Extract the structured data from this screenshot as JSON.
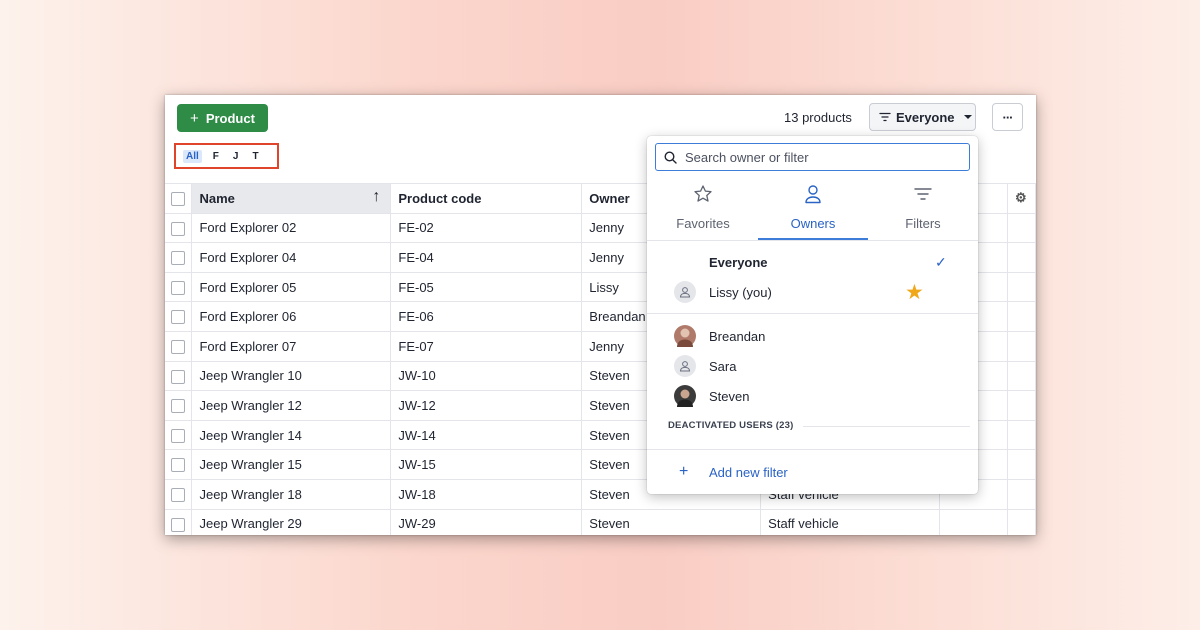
{
  "toolbar": {
    "add_label": "Product",
    "add_icon": "plus-icon",
    "alpha_filters": [
      "All",
      "F",
      "J",
      "T"
    ],
    "active_alpha": "All",
    "count": "13 products",
    "owner_filter_label": "Everyone",
    "more_label": "···"
  },
  "table": {
    "columns": [
      "Name",
      "Product code",
      "Owner",
      "",
      "",
      ""
    ],
    "sorted_column": "Name",
    "rows": [
      [
        "Ford Explorer 02",
        "FE-02",
        "Jenny",
        ""
      ],
      [
        "Ford Explorer 04",
        "FE-04",
        "Jenny",
        ""
      ],
      [
        "Ford Explorer 05",
        "FE-05",
        "Lissy",
        ""
      ],
      [
        "Ford Explorer 06",
        "FE-06",
        "Breandan",
        ""
      ],
      [
        "Ford Explorer 07",
        "FE-07",
        "Jenny",
        ""
      ],
      [
        "Jeep Wrangler 10",
        "JW-10",
        "Steven",
        ""
      ],
      [
        "Jeep Wrangler 12",
        "JW-12",
        "Steven",
        ""
      ],
      [
        "Jeep Wrangler 14",
        "JW-14",
        "Steven",
        ""
      ],
      [
        "Jeep Wrangler 15",
        "JW-15",
        "Steven",
        ""
      ],
      [
        "Jeep Wrangler 18",
        "JW-18",
        "Steven",
        "Staff vehicle"
      ],
      [
        "Jeep Wrangler 29",
        "JW-29",
        "Steven",
        "Staff vehicle"
      ]
    ]
  },
  "popup": {
    "search_placeholder": "Search owner or filter",
    "tabs": [
      {
        "label": "Favorites",
        "icon": "star-outline-icon"
      },
      {
        "label": "Owners",
        "icon": "person-icon"
      },
      {
        "label": "Filters",
        "icon": "filter-lines-icon"
      }
    ],
    "active_tab": "Owners",
    "everyone_label": "Everyone",
    "you_label": "Lissy (you)",
    "owners": [
      "Breandan",
      "Sara",
      "Steven"
    ],
    "deactivated_label": "DEACTIVATED USERS (23)",
    "add_filter_label": "Add new filter"
  },
  "colors": {
    "accent_green": "#2e8c47",
    "accent_blue": "#3d7cd9",
    "highlight_red": "#e0452b",
    "star_gold": "#f0a81a"
  }
}
